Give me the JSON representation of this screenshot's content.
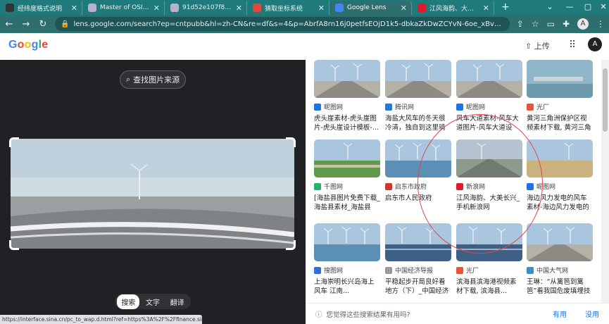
{
  "tabs": [
    {
      "label": "经纬度格式说明",
      "favicon_color": "#333333"
    },
    {
      "label": "Master of OSINT",
      "favicon_color": "#b9b0c9"
    },
    {
      "label": "91d52e107f83e20cf72a8",
      "favicon_color": "#b9b0c9"
    },
    {
      "label": "猜取坐标系统",
      "favicon_color": "#e8453c"
    },
    {
      "label": "Google Lens",
      "favicon_color": "#4285f4",
      "active": true
    },
    {
      "label": "江风海韵、大美长兴_手机",
      "favicon_color": "#e6162d"
    }
  ],
  "new_tab": "+",
  "address": {
    "url": "lens.google.com/search?ep=cntpubb&hl=zh-CN&re=df&s=4&p=AbrfA8rn16j0petfsEOjD1k5-dbkaZkDwZCYvN-6oe_xBvQsaiqSxwdmRf4d7QNLh07luwDFvKD1..."
  },
  "google": {
    "logo_letters": [
      {
        "ch": "G",
        "color": "#4285f4"
      },
      {
        "ch": "o",
        "color": "#ea4335"
      },
      {
        "ch": "o",
        "color": "#fbbc05"
      },
      {
        "ch": "g",
        "color": "#4285f4"
      },
      {
        "ch": "l",
        "color": "#34a853"
      },
      {
        "ch": "e",
        "color": "#ea4335"
      }
    ],
    "upload_label": "上传",
    "avatar_letter": "A"
  },
  "lens": {
    "find_source_label": "查找图片来源",
    "modes": [
      "搜索",
      "文字",
      "翻译"
    ],
    "selected_mode": "搜索"
  },
  "status_url": "https://interface.sina.cn/pc_to_wap.d.html?ref=https%3A%2F%2Ffinance.sina.com.cn%2F...",
  "results": [
    {
      "source": "昵图网",
      "title": "虎头崖素材-虎头崖图片-虎头崖设计模板-...",
      "icon_color": "#1a73e8",
      "scene": "road"
    },
    {
      "source": "腾讯网",
      "title": "海盐大风车的冬天很冷清，独自到这里骑行...",
      "icon_color": "#1f7bd8",
      "scene": "road"
    },
    {
      "source": "昵图网",
      "title": "风车大道素材-风车大道图片-风车大道设计...",
      "icon_color": "#1a73e8",
      "scene": "road"
    },
    {
      "source": "光厂",
      "title": "黄河三角洲保护区视频素材下载, 黄河三角洲...",
      "icon_color": "#e8553a",
      "scene": "water"
    },
    {
      "source": "千图网",
      "title": "[海盐县图片免费下载_海盐县素材_海盐县模...",
      "icon_color": "#24b36b",
      "scene": "grass"
    },
    {
      "source": "启东市政府",
      "title": "启东市人民政府",
      "icon_color": "#d6322a",
      "scene": "sea"
    },
    {
      "source": "新浪网",
      "title": "江风海韵、大美长兴_手机新浪网",
      "icon_color": "#e6162d",
      "scene": "dike"
    },
    {
      "source": "昵图网",
      "title": "海边风力发电的风车素材-海边风力发电的风...",
      "icon_color": "#1a73e8",
      "scene": "beach"
    },
    {
      "source": "搜图网",
      "title": "上海崇明长兴岛海上风车 江南...",
      "icon_color": "#2f6fd6",
      "scene": "sea"
    },
    {
      "source": "中国经济导报",
      "title": "平稳起步开局良好看地方（下）_中国经济导...",
      "icon_color": "#9a9a9a",
      "scene": "solar"
    },
    {
      "source": "光厂",
      "title": "滨海县滨海港视频素材下载, 滨海县...",
      "icon_color": "#e8553a",
      "scene": "solar"
    },
    {
      "source": "中国大气网",
      "title": "王琳：“从篱笆到篱笆”看我国危废填埋技术...",
      "icon_color": "#3b8fc4",
      "scene": "road"
    }
  ],
  "feedback": {
    "question": "您觉得这些搜索结果有用吗?",
    "yes": "有用",
    "no": "没用"
  },
  "colors": {
    "tab_bar": "#1e7a7b",
    "address_bar": "#2d6e6f",
    "lens_dark": "#202124",
    "annotation_circle": "#e0474c"
  }
}
